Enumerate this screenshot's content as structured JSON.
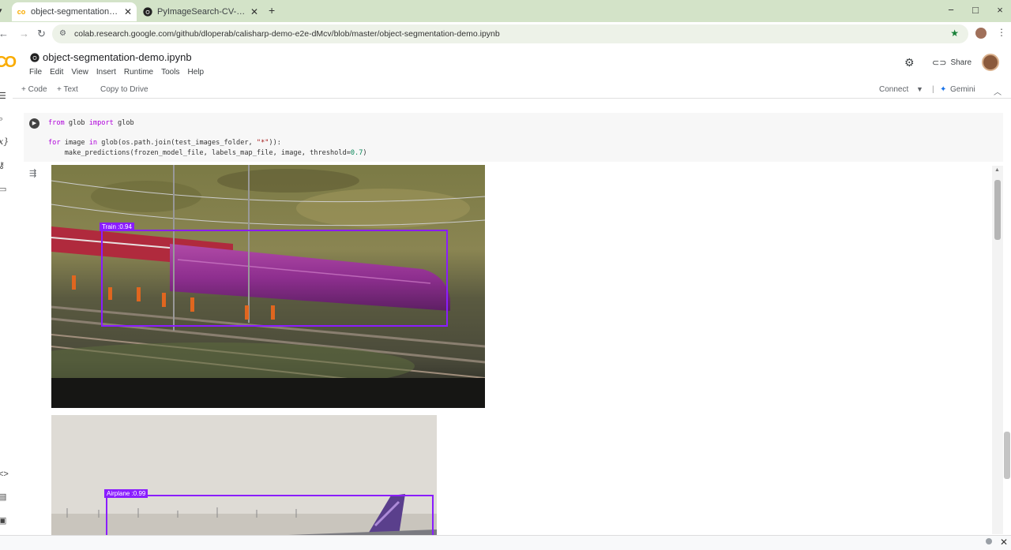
{
  "browser": {
    "tabs": [
      {
        "title": "object-segmentation-demo.ip",
        "active": true
      },
      {
        "title": "PyImageSearch-CV-DL-Crash...",
        "active": false
      }
    ],
    "new_tab": "+",
    "window": {
      "minimize": "−",
      "restore": "□",
      "close": "×"
    },
    "url": "colab.research.google.com/github/dloperab/calisharp-demo-e2e-dMcv/blob/master/object-segmentation-demo.ipynb"
  },
  "colab": {
    "logo": "CO",
    "notebook_title": "object-segmentation-demo.ipynb",
    "menu": [
      "File",
      "Edit",
      "View",
      "Insert",
      "Runtime",
      "Tools",
      "Help"
    ],
    "share_label": "Share",
    "toolbar": {
      "add_code": "+ Code",
      "add_text": "+ Text",
      "copy_to_drive": "Copy to Drive",
      "connect": "Connect",
      "gemini": "Gemini"
    }
  },
  "cell": {
    "code_lines": {
      "line1": {
        "kw1": "from",
        "mid": " glob ",
        "kw2": "import",
        "rest": " glob"
      },
      "line3": {
        "kw1": "for",
        "a": " image ",
        "kw2": "in",
        "b": " glob(os.path.join(test_images_folder, ",
        "str": "\"*\"",
        "c": ")):"
      },
      "line4": {
        "a": "    make_predictions(frozen_model_file, labels_map_file, image, threshold=",
        "num": "0.7",
        "b": ")"
      }
    }
  },
  "outputs": [
    {
      "label": "Train :0.94",
      "class": "Train",
      "score": 0.94
    },
    {
      "label": "Airplane :0.99",
      "class": "Airplane",
      "score": 0.99
    }
  ],
  "colors": {
    "accent": "#8a1dff",
    "colab_orange": "#f9ab00",
    "tab_strip": "#d3e3c8"
  }
}
